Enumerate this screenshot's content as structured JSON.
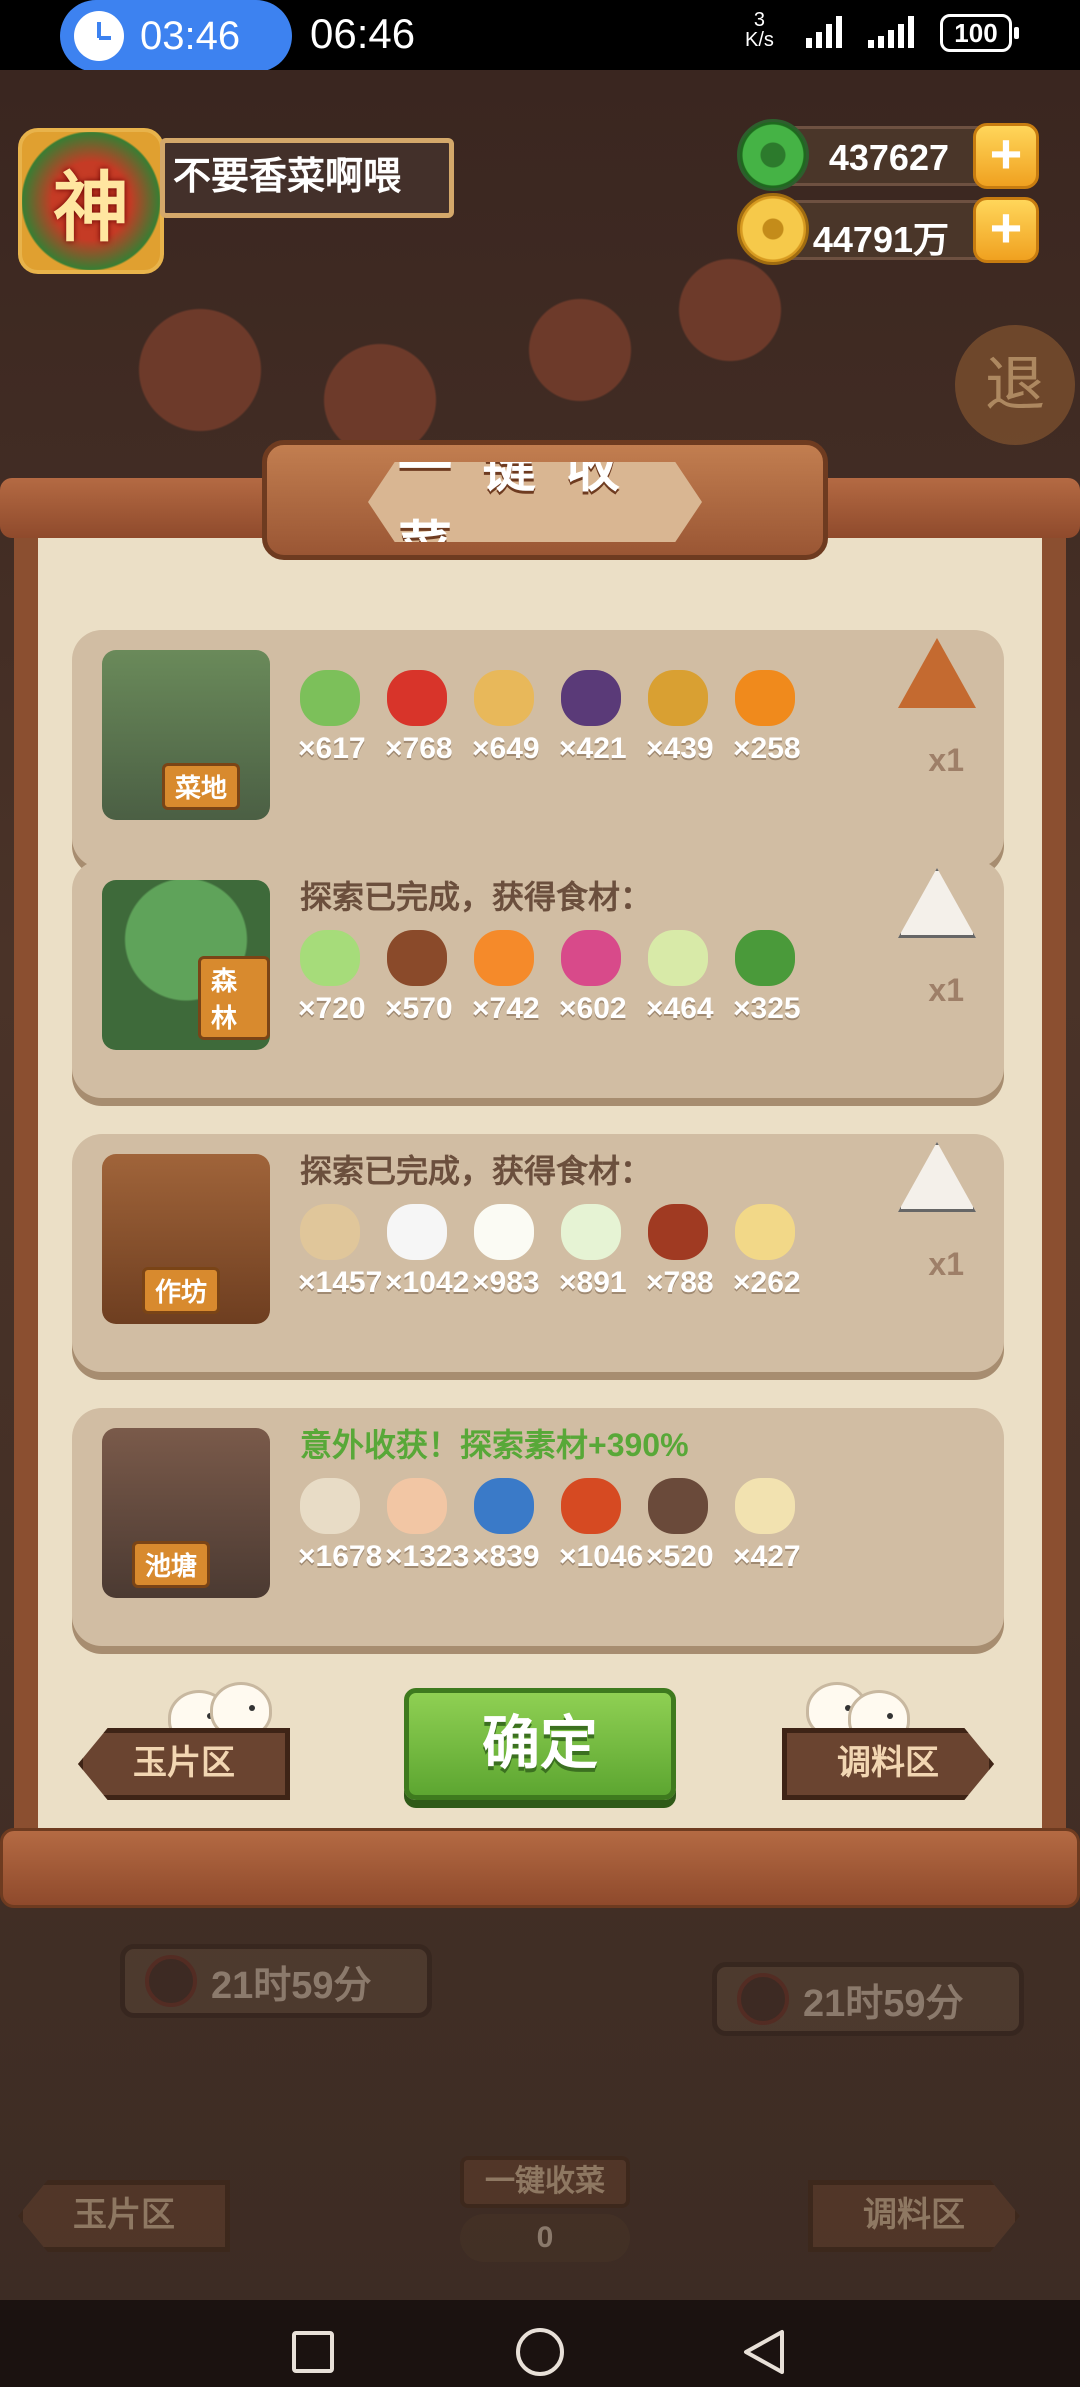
{
  "status_bar": {
    "timer": "03:46",
    "clock": "06:46",
    "net_speed_value": "3",
    "net_speed_unit": "K/s",
    "battery": "100"
  },
  "player": {
    "avatar_glyph": "神",
    "name": "不要香菜啊喂",
    "jade": "437627",
    "gold": "44791万"
  },
  "exit_label": "退",
  "dialog": {
    "title": "一键收菜",
    "cards": [
      {
        "tag": "菜地",
        "message": "",
        "items": [
          {
            "icon": "scallion-icon",
            "count": "×617"
          },
          {
            "icon": "chili-icon",
            "count": "×768"
          },
          {
            "icon": "potato-icon",
            "count": "×649"
          },
          {
            "icon": "eggplant-icon",
            "count": "×421"
          },
          {
            "icon": "corn-pineapple-icon",
            "count": "×439"
          },
          {
            "icon": "pumpkin-icon",
            "count": "×258"
          }
        ],
        "reward_multiplier": "x1"
      },
      {
        "tag": "森林",
        "message": "探索已完成，获得食材：",
        "items": [
          {
            "icon": "cabbage-icon",
            "count": "×720"
          },
          {
            "icon": "mushroom-icon",
            "count": "×570"
          },
          {
            "icon": "carrot-icon",
            "count": "×742"
          },
          {
            "icon": "radish-icon",
            "count": "×602"
          },
          {
            "icon": "bamboo-shoot-icon",
            "count": "×464"
          },
          {
            "icon": "herb-icon",
            "count": "×325"
          }
        ],
        "reward_multiplier": "x1"
      },
      {
        "tag": "作坊",
        "message": "探索已完成，获得食材：",
        "items": [
          {
            "icon": "flour-sack-icon",
            "count": "×1457"
          },
          {
            "icon": "rice-bowl-icon",
            "count": "×1042"
          },
          {
            "icon": "tofu-icon",
            "count": "×983"
          },
          {
            "icon": "rice-dish-icon",
            "count": "×891"
          },
          {
            "icon": "sauce-jar-icon",
            "count": "×788"
          },
          {
            "icon": "gravy-boat-icon",
            "count": "×262"
          }
        ],
        "reward_multiplier": "x1"
      },
      {
        "tag": "池塘",
        "message": "意外收获！探索素材+390%",
        "items": [
          {
            "icon": "clam-icon",
            "count": "×1678"
          },
          {
            "icon": "shrimp-icon",
            "count": "×1323"
          },
          {
            "icon": "fish-icon",
            "count": "×839"
          },
          {
            "icon": "meat-icon",
            "count": "×1046"
          },
          {
            "icon": "crab-icon",
            "count": "×520"
          },
          {
            "icon": "fin-icon",
            "count": "×427"
          }
        ],
        "reward_multiplier": ""
      }
    ],
    "left_button": "玉片区",
    "confirm_button": "确定",
    "right_button": "调料区"
  },
  "background": {
    "timer_left": "21时59分",
    "timer_right": "21时59分",
    "collect_button": "一键收菜",
    "left_sign": "玉片区",
    "right_sign": "调料区",
    "count": "0"
  },
  "colors": {
    "confirm_green": "#5da631",
    "bonus_text_green": "#58a838",
    "parchment": "#ebdfc6",
    "card": "#d1bda3",
    "wood": "#8b4f30"
  }
}
